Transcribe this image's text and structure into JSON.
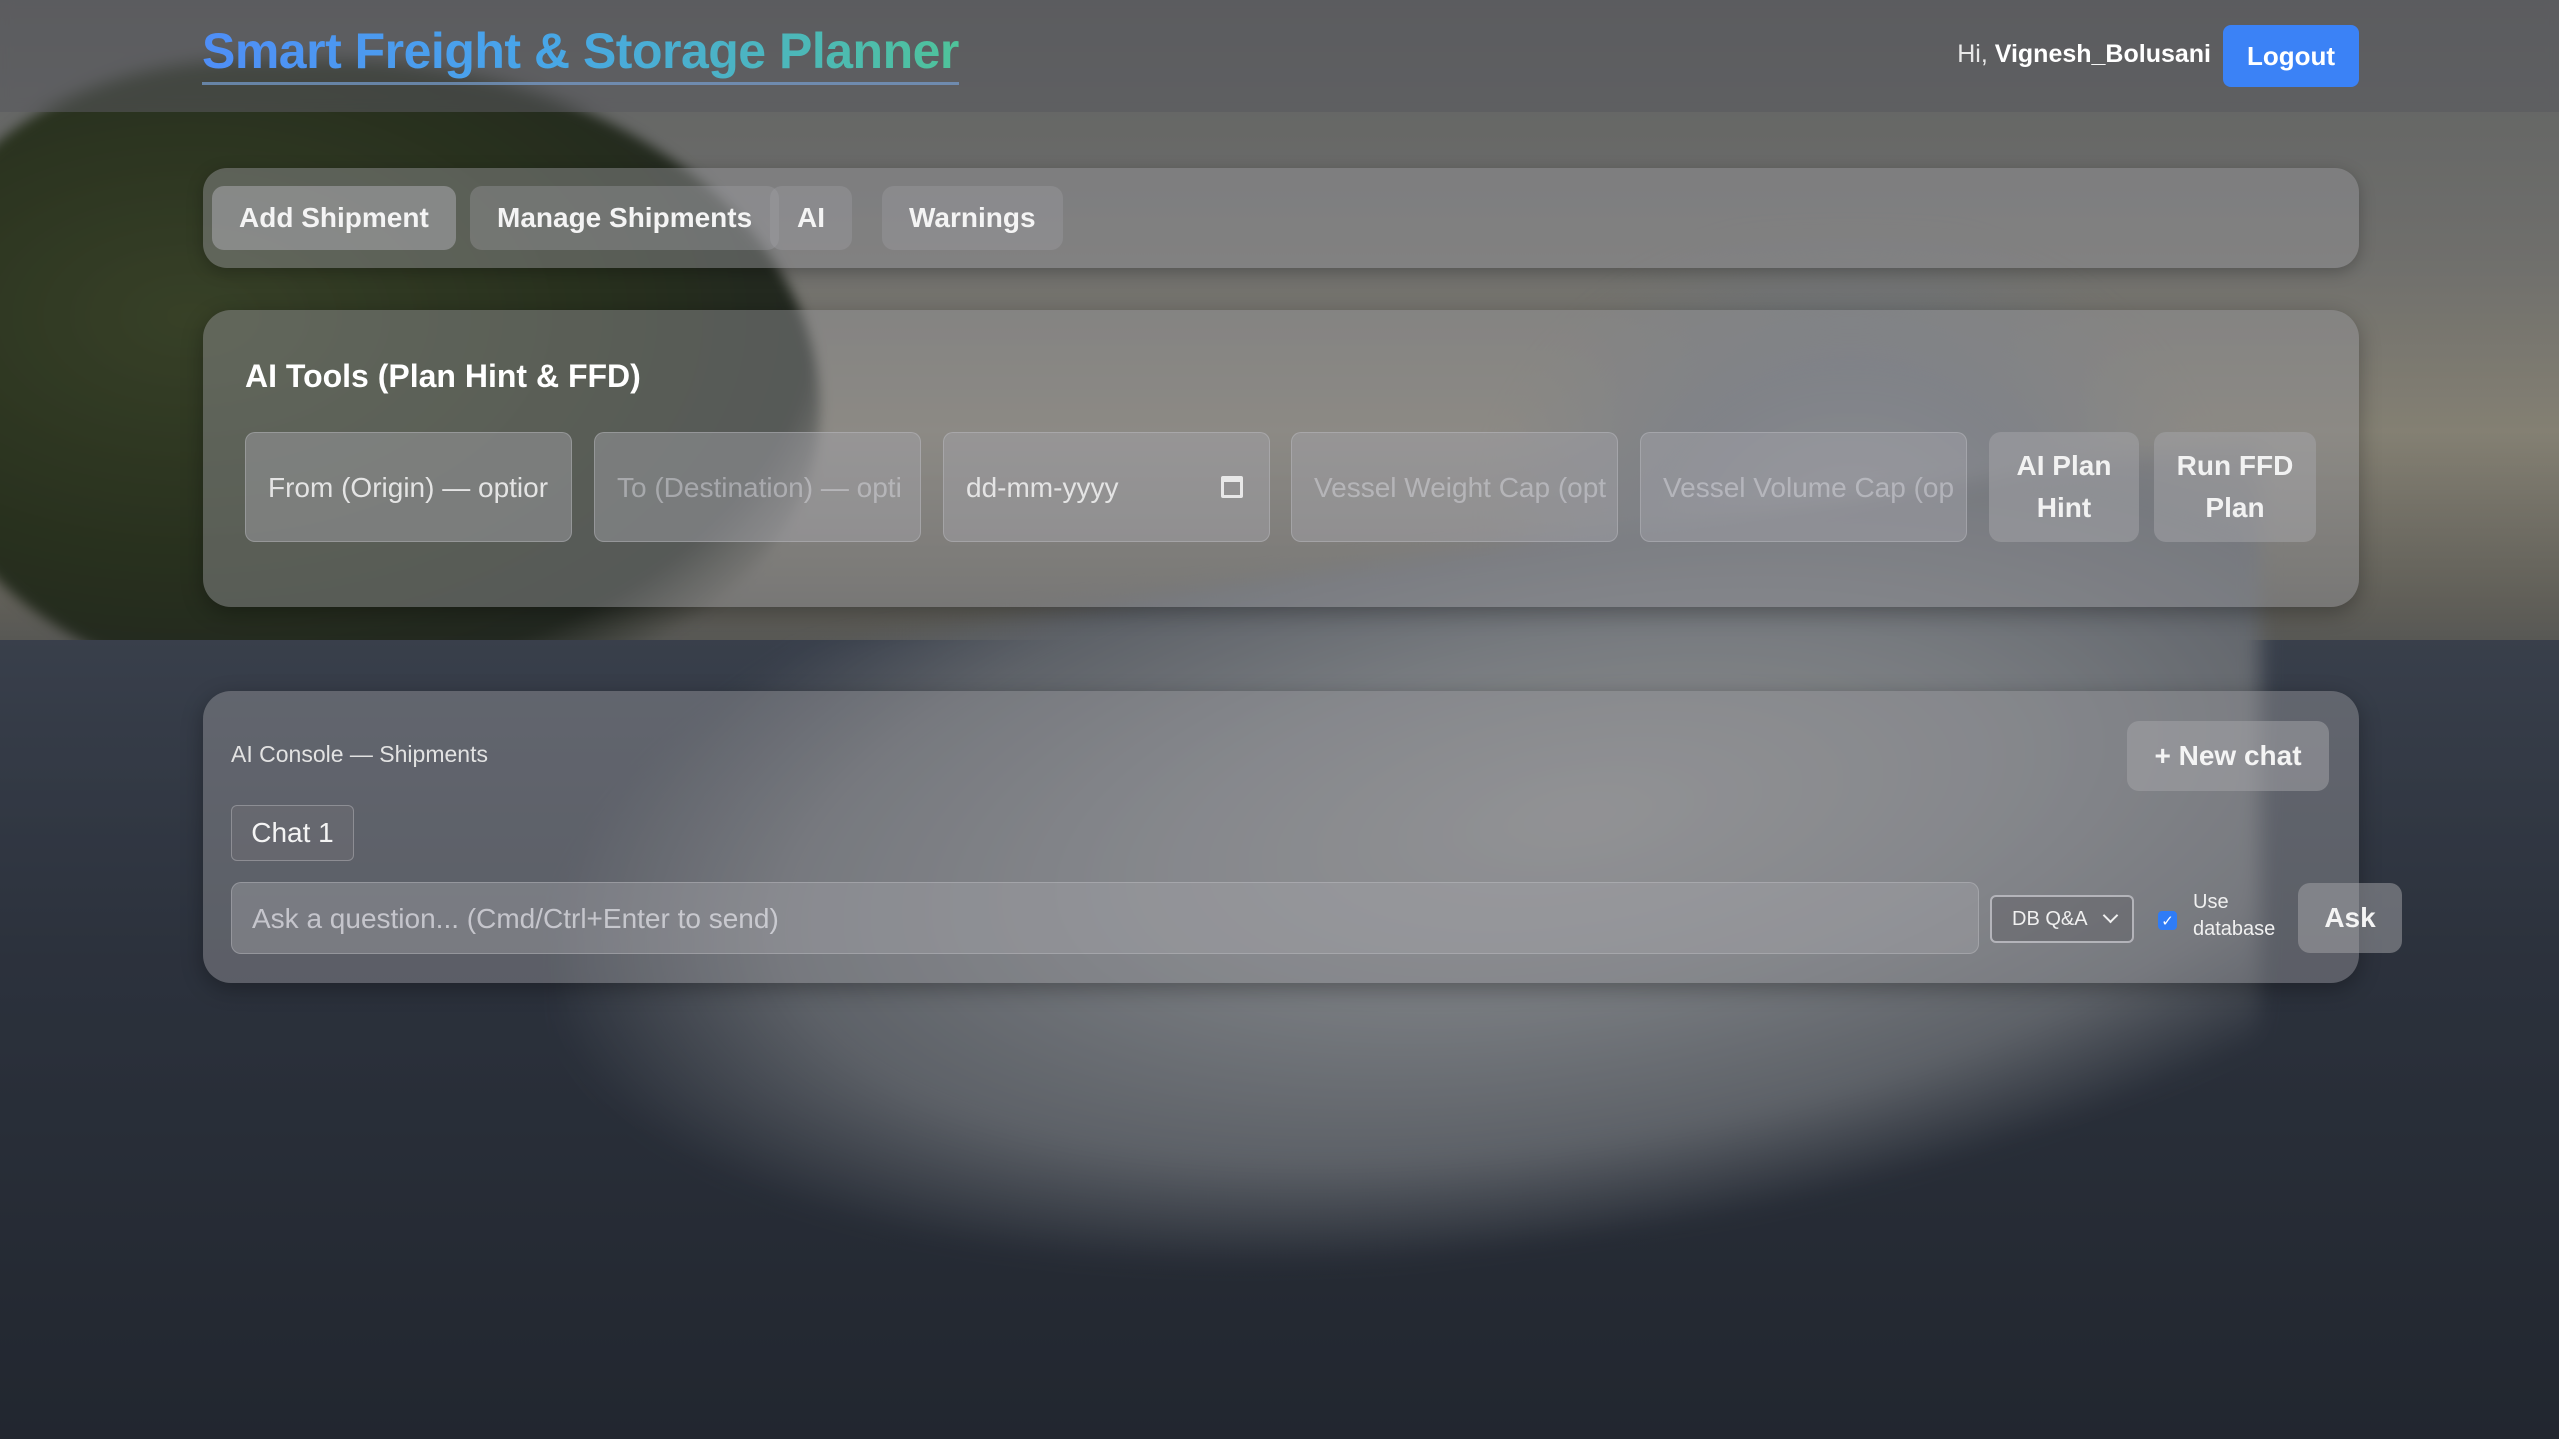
{
  "header": {
    "app_title": "Smart Freight & Storage Planner",
    "greeting_prefix": "Hi,",
    "username": "Vignesh_Bolusani",
    "logout_label": "Logout"
  },
  "tabs": [
    {
      "label": "Add Shipment",
      "active": true
    },
    {
      "label": "Manage Shipments",
      "active": false
    },
    {
      "label": "AI",
      "active": false
    },
    {
      "label": "Warnings",
      "active": false
    }
  ],
  "ai_tools": {
    "title": "AI Tools (Plan Hint & FFD)",
    "origin_placeholder": "From (Origin) — optior",
    "destination_placeholder": "To (Destination) — opti",
    "date_placeholder": "dd-mm-yyyy",
    "weight_placeholder": "Vessel Weight Cap (opt",
    "volume_placeholder": "Vessel Volume Cap (op",
    "plan_hint_label": "AI Plan Hint",
    "ffd_label": "Run FFD Plan"
  },
  "console": {
    "label": "AI Console — Shipments",
    "new_chat_label": "+ New chat",
    "chat_tab_label": "Chat 1",
    "ask_placeholder": "Ask a question... (Cmd/Ctrl+Enter to send)",
    "mode_selected": "DB Q&A",
    "use_database_label": "Use database",
    "use_database_checked": true,
    "ask_label": "Ask"
  },
  "colors": {
    "accent": "#3b82f6",
    "title_gradient_start": "#4f8ef7",
    "title_gradient_end": "#4fc39a"
  },
  "icons": [
    "calendar-icon",
    "chevron-down-icon",
    "checkmark-icon"
  ]
}
